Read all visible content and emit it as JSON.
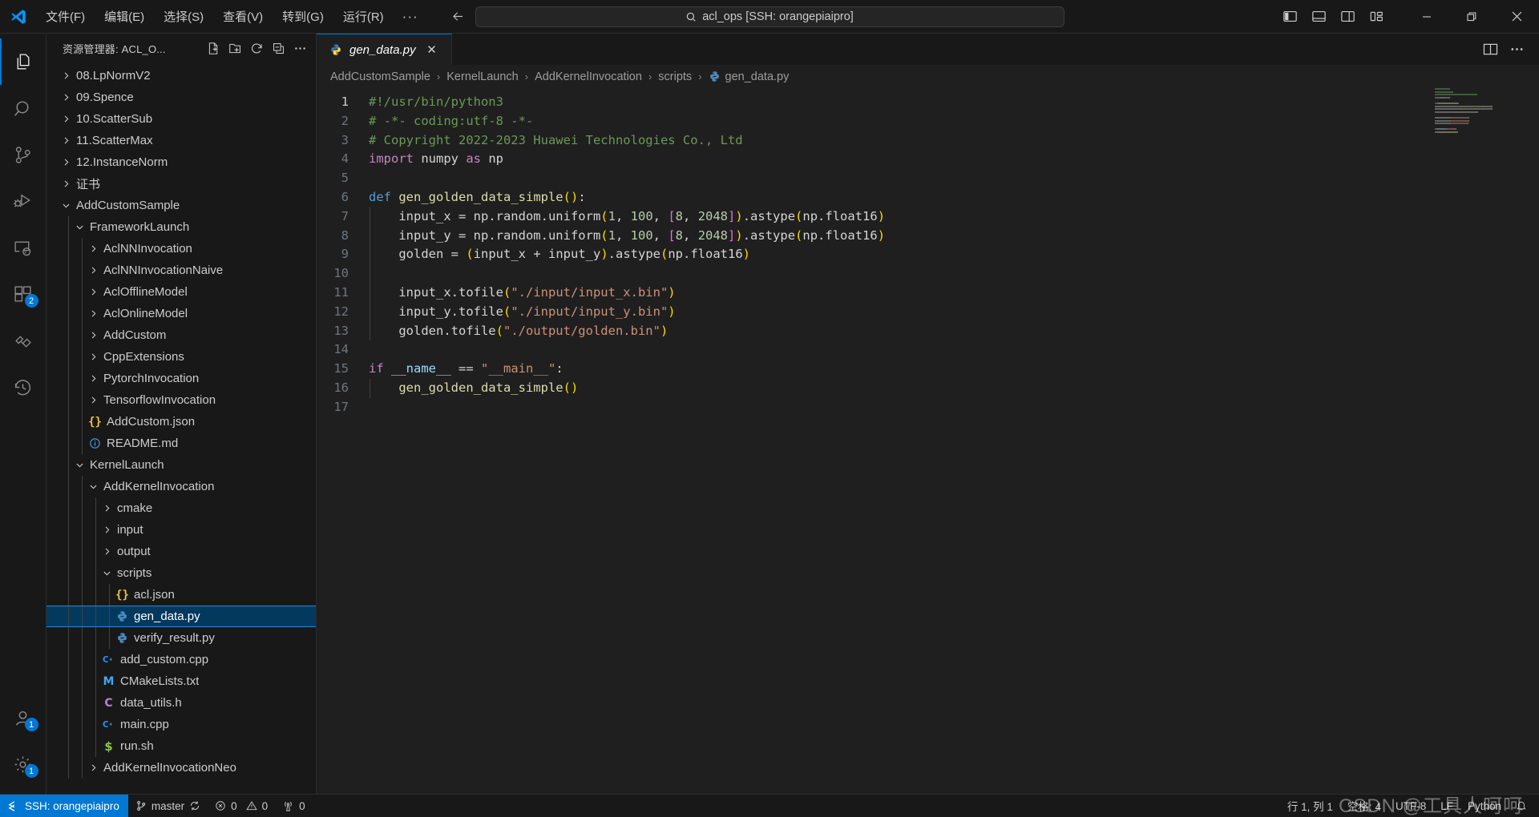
{
  "titlebar": {
    "logo": "vscode-logo",
    "menu": [
      "文件(F)",
      "编辑(E)",
      "选择(S)",
      "查看(V)",
      "转到(G)",
      "运行(R)"
    ],
    "more": "···",
    "search_value": "acl_ops [SSH: orangepiaipro]",
    "layout_buttons": [
      "toggle-primary-sidebar",
      "toggle-panel",
      "toggle-secondary-sidebar",
      "customize-layout"
    ],
    "window_buttons": [
      "minimize",
      "restore",
      "close"
    ]
  },
  "activitybar": {
    "items": [
      {
        "name": "explorer",
        "icon": "files-icon",
        "active": true,
        "badge": ""
      },
      {
        "name": "search",
        "icon": "search-icon",
        "active": false,
        "badge": ""
      },
      {
        "name": "source-control",
        "icon": "source-control-icon",
        "active": false,
        "badge": ""
      },
      {
        "name": "run-and-debug",
        "icon": "run-debug-icon",
        "active": false,
        "badge": ""
      },
      {
        "name": "remote-explorer",
        "icon": "remote-explorer-icon",
        "active": false,
        "badge": ""
      },
      {
        "name": "extensions",
        "icon": "extensions-icon",
        "active": false,
        "badge": "2"
      },
      {
        "name": "testing",
        "icon": "testing-icon",
        "active": false,
        "badge": ""
      },
      {
        "name": "timeline",
        "icon": "history-icon",
        "active": false,
        "badge": ""
      }
    ],
    "bottom": [
      {
        "name": "accounts",
        "icon": "account-icon",
        "badge": "1"
      },
      {
        "name": "manage",
        "icon": "gear-icon",
        "badge": "1"
      }
    ]
  },
  "sidebar": {
    "title": "资源管理器: ACL_O...",
    "actions": [
      "new-file-icon",
      "new-folder-icon",
      "refresh-icon",
      "collapse-all-icon",
      "more-actions-icon"
    ],
    "tree": [
      {
        "label": "08.LpNormV2",
        "depth": 0,
        "type": "folder",
        "state": "collapsed"
      },
      {
        "label": "09.Spence",
        "depth": 0,
        "type": "folder",
        "state": "collapsed"
      },
      {
        "label": "10.ScatterSub",
        "depth": 0,
        "type": "folder",
        "state": "collapsed"
      },
      {
        "label": "11.ScatterMax",
        "depth": 0,
        "type": "folder",
        "state": "collapsed"
      },
      {
        "label": "12.InstanceNorm",
        "depth": 0,
        "type": "folder",
        "state": "collapsed"
      },
      {
        "label": "证书",
        "depth": 0,
        "type": "folder",
        "state": "collapsed"
      },
      {
        "label": "AddCustomSample",
        "depth": 0,
        "type": "folder",
        "state": "expanded"
      },
      {
        "label": "FrameworkLaunch",
        "depth": 1,
        "type": "folder",
        "state": "expanded"
      },
      {
        "label": "AclNNInvocation",
        "depth": 2,
        "type": "folder",
        "state": "collapsed"
      },
      {
        "label": "AclNNInvocationNaive",
        "depth": 2,
        "type": "folder",
        "state": "collapsed"
      },
      {
        "label": "AclOfflineModel",
        "depth": 2,
        "type": "folder",
        "state": "collapsed"
      },
      {
        "label": "AclOnlineModel",
        "depth": 2,
        "type": "folder",
        "state": "collapsed"
      },
      {
        "label": "AddCustom",
        "depth": 2,
        "type": "folder",
        "state": "collapsed"
      },
      {
        "label": "CppExtensions",
        "depth": 2,
        "type": "folder",
        "state": "collapsed"
      },
      {
        "label": "PytorchInvocation",
        "depth": 2,
        "type": "folder",
        "state": "collapsed"
      },
      {
        "label": "TensorflowInvocation",
        "depth": 2,
        "type": "folder",
        "state": "collapsed"
      },
      {
        "label": "AddCustom.json",
        "depth": 2,
        "type": "file",
        "icon": "json-file-icon"
      },
      {
        "label": "README.md",
        "depth": 2,
        "type": "file",
        "icon": "markdown-file-icon"
      },
      {
        "label": "KernelLaunch",
        "depth": 1,
        "type": "folder",
        "state": "expanded"
      },
      {
        "label": "AddKernelInvocation",
        "depth": 2,
        "type": "folder",
        "state": "expanded"
      },
      {
        "label": "cmake",
        "depth": 3,
        "type": "folder",
        "state": "collapsed"
      },
      {
        "label": "input",
        "depth": 3,
        "type": "folder",
        "state": "collapsed"
      },
      {
        "label": "output",
        "depth": 3,
        "type": "folder",
        "state": "collapsed"
      },
      {
        "label": "scripts",
        "depth": 3,
        "type": "folder",
        "state": "expanded"
      },
      {
        "label": "acl.json",
        "depth": 4,
        "type": "file",
        "icon": "json-file-icon"
      },
      {
        "label": "gen_data.py",
        "depth": 4,
        "type": "file",
        "icon": "python-file-icon",
        "selected": true
      },
      {
        "label": "verify_result.py",
        "depth": 4,
        "type": "file",
        "icon": "python-file-icon"
      },
      {
        "label": "add_custom.cpp",
        "depth": 3,
        "type": "file",
        "icon": "cpp-file-icon"
      },
      {
        "label": "CMakeLists.txt",
        "depth": 3,
        "type": "file",
        "icon": "cmake-file-icon"
      },
      {
        "label": "data_utils.h",
        "depth": 3,
        "type": "file",
        "icon": "c-header-file-icon"
      },
      {
        "label": "main.cpp",
        "depth": 3,
        "type": "file",
        "icon": "cpp-file-icon"
      },
      {
        "label": "run.sh",
        "depth": 3,
        "type": "file",
        "icon": "shell-file-icon"
      },
      {
        "label": "AddKernelInvocationNeo",
        "depth": 2,
        "type": "folder",
        "state": "collapsed"
      }
    ]
  },
  "editor": {
    "tab": {
      "label": "gen_data.py",
      "icon": "python-file-icon",
      "close": "✕",
      "preview": true
    },
    "tab_actions": [
      "split-editor-icon",
      "more-actions-icon"
    ],
    "breadcrumb": [
      "AddCustomSample",
      "KernelLaunch",
      "AddKernelInvocation",
      "scripts",
      "gen_data.py"
    ],
    "breadcrumb_sep": "›",
    "lines": [
      {
        "n": 1,
        "tokens": [
          {
            "t": "#!/usr/bin/python3",
            "c": "cmt"
          }
        ]
      },
      {
        "n": 2,
        "tokens": [
          {
            "t": "# -*- coding:utf-8 -*-",
            "c": "cmt"
          }
        ]
      },
      {
        "n": 3,
        "tokens": [
          {
            "t": "# Copyright 2022-2023 Huawei Technologies Co., Ltd",
            "c": "cmt"
          }
        ]
      },
      {
        "n": 4,
        "tokens": [
          {
            "t": "import",
            "c": "kw2"
          },
          {
            "t": " numpy ",
            "c": "plain"
          },
          {
            "t": "as",
            "c": "kw2"
          },
          {
            "t": " np",
            "c": "plain"
          }
        ]
      },
      {
        "n": 5,
        "tokens": []
      },
      {
        "n": 6,
        "tokens": [
          {
            "t": "def",
            "c": "kw"
          },
          {
            "t": " ",
            "c": "plain"
          },
          {
            "t": "gen_golden_data_simple",
            "c": "fn"
          },
          {
            "t": "(",
            "c": "py1"
          },
          {
            "t": ")",
            "c": "py1"
          },
          {
            "t": ":",
            "c": "plain"
          }
        ]
      },
      {
        "n": 7,
        "indent": 1,
        "tokens": [
          {
            "t": "    input_x = np.random.uniform",
            "c": "plain"
          },
          {
            "t": "(",
            "c": "py1"
          },
          {
            "t": "1",
            "c": "num"
          },
          {
            "t": ", ",
            "c": "plain"
          },
          {
            "t": "100",
            "c": "num"
          },
          {
            "t": ", ",
            "c": "plain"
          },
          {
            "t": "[",
            "c": "py2"
          },
          {
            "t": "8",
            "c": "num"
          },
          {
            "t": ", ",
            "c": "plain"
          },
          {
            "t": "2048",
            "c": "num"
          },
          {
            "t": "]",
            "c": "py2"
          },
          {
            "t": ")",
            "c": "py1"
          },
          {
            "t": ".astype",
            "c": "plain"
          },
          {
            "t": "(",
            "c": "py1"
          },
          {
            "t": "np.float16",
            "c": "plain"
          },
          {
            "t": ")",
            "c": "py1"
          }
        ]
      },
      {
        "n": 8,
        "indent": 1,
        "tokens": [
          {
            "t": "    input_y = np.random.uniform",
            "c": "plain"
          },
          {
            "t": "(",
            "c": "py1"
          },
          {
            "t": "1",
            "c": "num"
          },
          {
            "t": ", ",
            "c": "plain"
          },
          {
            "t": "100",
            "c": "num"
          },
          {
            "t": ", ",
            "c": "plain"
          },
          {
            "t": "[",
            "c": "py2"
          },
          {
            "t": "8",
            "c": "num"
          },
          {
            "t": ", ",
            "c": "plain"
          },
          {
            "t": "2048",
            "c": "num"
          },
          {
            "t": "]",
            "c": "py2"
          },
          {
            "t": ")",
            "c": "py1"
          },
          {
            "t": ".astype",
            "c": "plain"
          },
          {
            "t": "(",
            "c": "py1"
          },
          {
            "t": "np.float16",
            "c": "plain"
          },
          {
            "t": ")",
            "c": "py1"
          }
        ]
      },
      {
        "n": 9,
        "indent": 1,
        "tokens": [
          {
            "t": "    golden = ",
            "c": "plain"
          },
          {
            "t": "(",
            "c": "py1"
          },
          {
            "t": "input_x + input_y",
            "c": "plain"
          },
          {
            "t": ")",
            "c": "py1"
          },
          {
            "t": ".astype",
            "c": "plain"
          },
          {
            "t": "(",
            "c": "py1"
          },
          {
            "t": "np.float16",
            "c": "plain"
          },
          {
            "t": ")",
            "c": "py1"
          }
        ]
      },
      {
        "n": 10,
        "indent": 1,
        "tokens": []
      },
      {
        "n": 11,
        "indent": 1,
        "tokens": [
          {
            "t": "    input_x.tofile",
            "c": "plain"
          },
          {
            "t": "(",
            "c": "py1"
          },
          {
            "t": "\"./input/input_x.bin\"",
            "c": "str"
          },
          {
            "t": ")",
            "c": "py1"
          }
        ]
      },
      {
        "n": 12,
        "indent": 1,
        "tokens": [
          {
            "t": "    input_y.tofile",
            "c": "plain"
          },
          {
            "t": "(",
            "c": "py1"
          },
          {
            "t": "\"./input/input_y.bin\"",
            "c": "str"
          },
          {
            "t": ")",
            "c": "py1"
          }
        ]
      },
      {
        "n": 13,
        "indent": 1,
        "tokens": [
          {
            "t": "    golden.tofile",
            "c": "plain"
          },
          {
            "t": "(",
            "c": "py1"
          },
          {
            "t": "\"./output/golden.bin\"",
            "c": "str"
          },
          {
            "t": ")",
            "c": "py1"
          }
        ]
      },
      {
        "n": 14,
        "tokens": []
      },
      {
        "n": 15,
        "tokens": [
          {
            "t": "if",
            "c": "kw2"
          },
          {
            "t": " ",
            "c": "plain"
          },
          {
            "t": "__name__",
            "c": "var"
          },
          {
            "t": " == ",
            "c": "plain"
          },
          {
            "t": "\"__main__\"",
            "c": "str"
          },
          {
            "t": ":",
            "c": "plain"
          }
        ]
      },
      {
        "n": 16,
        "indent": 1,
        "tokens": [
          {
            "t": "    ",
            "c": "plain"
          },
          {
            "t": "gen_golden_data_simple",
            "c": "fn"
          },
          {
            "t": "(",
            "c": "py1"
          },
          {
            "t": ")",
            "c": "py1"
          }
        ]
      },
      {
        "n": 17,
        "tokens": []
      }
    ]
  },
  "statusbar": {
    "remote": {
      "icon": "remote-icon",
      "label": "SSH: orangepiaipro"
    },
    "branch": {
      "icon": "source-control-icon",
      "label": "master",
      "sync_icon": "sync-icon"
    },
    "problems": {
      "error_icon": "error-icon",
      "errors": "0",
      "warning_icon": "warning-icon",
      "warnings": "0"
    },
    "ports": {
      "icon": "radio-tower-icon",
      "count": "0"
    },
    "cursor_position": "行 1, 列 1",
    "indentation": "空格: 4",
    "encoding": "UTF-8",
    "eol": "LF",
    "language": "Python",
    "bell_icon": "bell-icon",
    "watermark": "CSDN @工具人呵呵"
  }
}
